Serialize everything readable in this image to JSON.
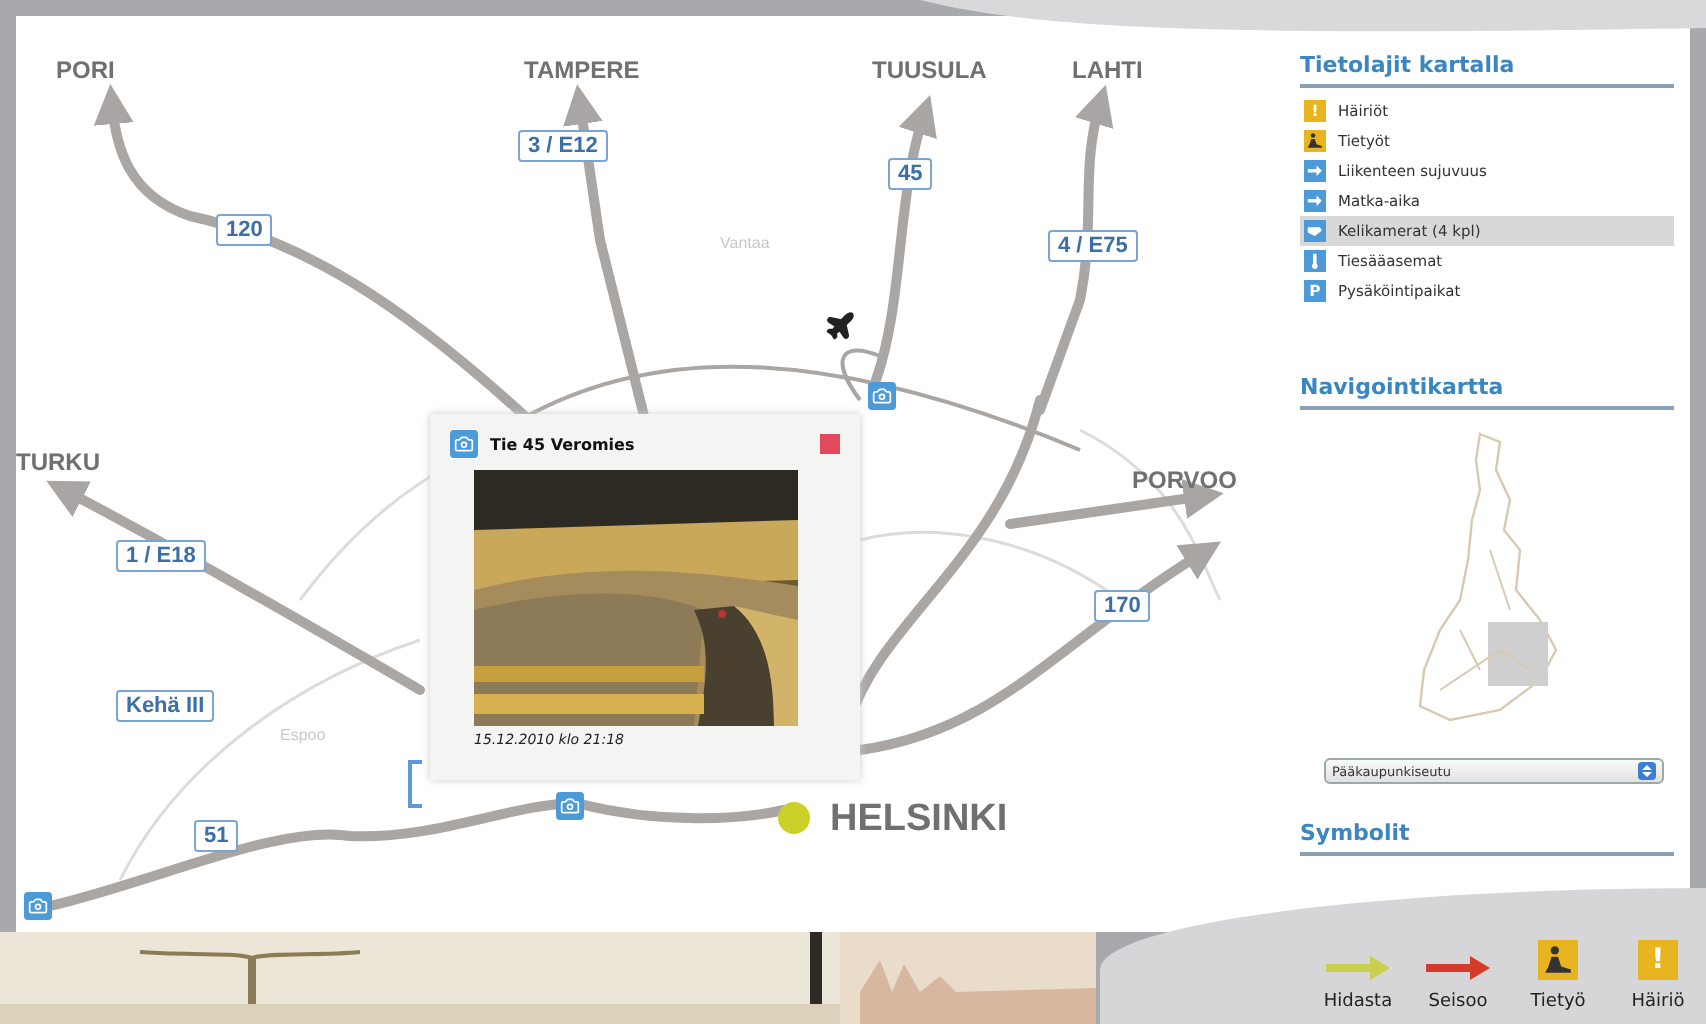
{
  "map": {
    "places": [
      {
        "name": "PORI",
        "kind": "city"
      },
      {
        "name": "TAMPERE",
        "kind": "city"
      },
      {
        "name": "TUUSULA",
        "kind": "city"
      },
      {
        "name": "LAHTI",
        "kind": "city"
      },
      {
        "name": "TURKU",
        "kind": "city"
      },
      {
        "name": "PORVOO",
        "kind": "city"
      },
      {
        "name": "HELSINKI",
        "kind": "capital"
      },
      {
        "name": "Vantaa",
        "kind": "area"
      },
      {
        "name": "Espoo",
        "kind": "area"
      }
    ],
    "road_numbers": [
      "120",
      "3 / E12",
      "45",
      "4 / E75",
      "1 / E18",
      "170",
      "Kehä III",
      "51"
    ],
    "popup": {
      "title": "Tie 45 Veromies",
      "timestamp": "15.12.2010 klo 21:18"
    }
  },
  "sidebar": {
    "legend": {
      "title": "Tietolajit kartalla",
      "items": [
        {
          "label": "Häiriöt",
          "kind": "warning",
          "icon_text": "!",
          "color": "#e8b520",
          "selected": false
        },
        {
          "label": "Tietyöt",
          "kind": "roadwork",
          "color": "#e8b520",
          "selected": false
        },
        {
          "label": "Liikenteen sujuvuus",
          "kind": "arrow",
          "color": "#4d9ad8",
          "selected": false
        },
        {
          "label": "Matka-aika",
          "kind": "arrow",
          "color": "#4d9ad8",
          "selected": false
        },
        {
          "label": "Kelikamerat (4 kpl)",
          "kind": "camera",
          "color": "#4d9ad8",
          "selected": true
        },
        {
          "label": "Tiesääasemat",
          "kind": "weather",
          "color": "#4d9ad8",
          "selected": false
        },
        {
          "label": "Pysäköintipaikat",
          "kind": "parking",
          "icon_text": "P",
          "color": "#4d9ad8",
          "selected": false
        }
      ]
    },
    "navigation": {
      "title": "Navigointikartta",
      "region_select": "Pääkaupunkiseutu"
    },
    "symbols": {
      "title": "Symbolit",
      "items": [
        {
          "label": "Hidasta",
          "kind": "arrow",
          "color": "#c8cf4a"
        },
        {
          "label": "Seisoo",
          "kind": "arrow",
          "color": "#d63a2a"
        },
        {
          "label": "Tietyö",
          "kind": "roadwork",
          "color": "#e8b520"
        },
        {
          "label": "Häiriö",
          "kind": "warning",
          "icon_text": "!",
          "color": "#e8b520"
        }
      ]
    }
  }
}
